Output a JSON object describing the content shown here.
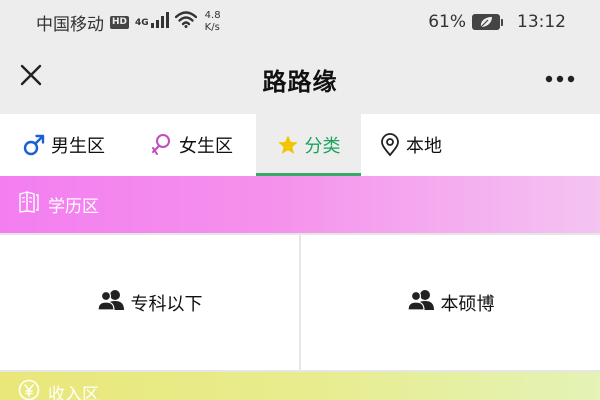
{
  "status_bar": {
    "carrier": "中国移动",
    "hd_badge": "HD",
    "network_type": "4G",
    "speed_value": "4.8",
    "speed_unit": "K/s",
    "battery_percent": "61%",
    "time": "13:12"
  },
  "header": {
    "title": "路路缘",
    "close_icon": "close-icon",
    "more_icon": "more-horizontal-icon"
  },
  "tabs": [
    {
      "label": "男生区",
      "icon": "male-symbol-icon",
      "color": "#1a5fd6"
    },
    {
      "label": "女生区",
      "icon": "female-symbol-icon",
      "color": "#c24bbf"
    },
    {
      "label": "分类",
      "icon": "star-icon",
      "color": "#f2c500",
      "active": true
    },
    {
      "label": "本地",
      "icon": "location-pin-icon",
      "color": "#222222"
    }
  ],
  "sections": [
    {
      "label": "学历区",
      "icon": "book-icon",
      "items": [
        {
          "label": "专科以下",
          "icon": "users-icon"
        },
        {
          "label": "本硕博",
          "icon": "users-icon"
        }
      ]
    },
    {
      "label": "收入区",
      "icon": "yen-circle-icon"
    }
  ],
  "colors": {
    "active_tab_text": "#1aa35a",
    "active_tab_underline": "#3aa968",
    "edu_banner": "#f37ef0",
    "income_banner": "#e9e779"
  }
}
